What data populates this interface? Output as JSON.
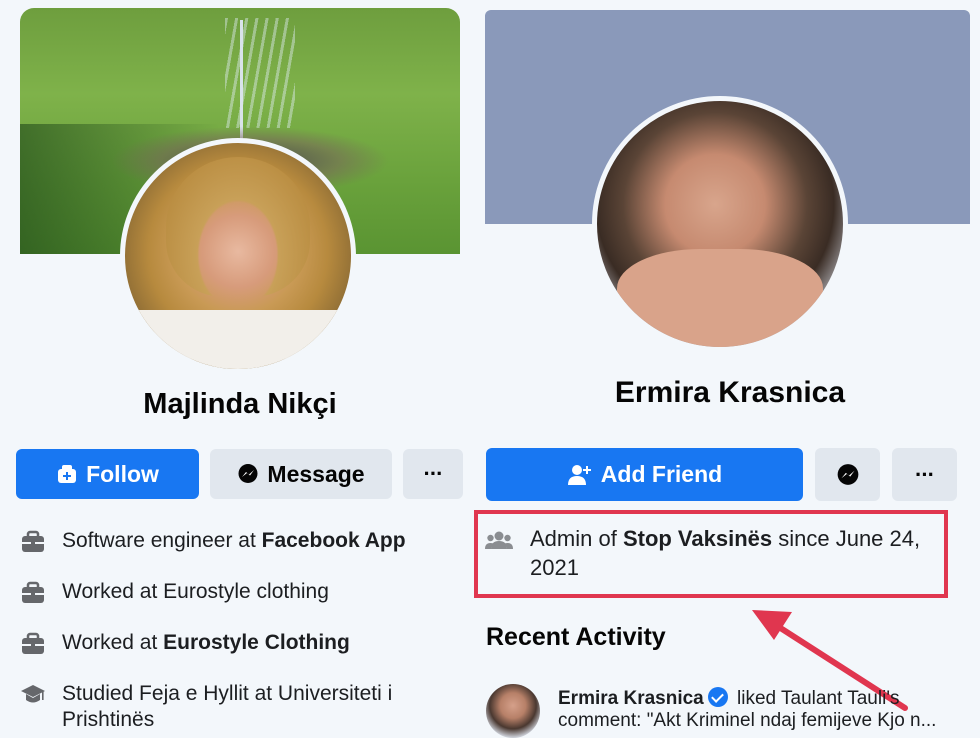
{
  "colors": {
    "primary": "#1877f2",
    "secondary_button": "#e1e7ee",
    "highlight_box": "#e0364f",
    "background": "#f3f7fb"
  },
  "left_profile": {
    "name": "Majlinda Nikçi",
    "follow_label": "Follow",
    "message_label": "Message",
    "more_label": "···",
    "info": [
      {
        "icon": "briefcase-icon",
        "prefix": "Software engineer at ",
        "bold": "Facebook App",
        "suffix": ""
      },
      {
        "icon": "briefcase-icon",
        "prefix": "Worked at Eurostyle clothing",
        "bold": "",
        "suffix": ""
      },
      {
        "icon": "briefcase-icon",
        "prefix": "Worked at ",
        "bold": "Eurostyle Clothing",
        "suffix": ""
      },
      {
        "icon": "graduation-cap-icon",
        "prefix": "Studied Feja e Hyllit at Universiteti i Prishtinës",
        "bold": "",
        "suffix": ""
      }
    ]
  },
  "right_profile": {
    "name": "Ermira Krasnica",
    "add_friend_label": "Add Friend",
    "more_label": "···",
    "admin": {
      "prefix": "Admin of ",
      "group": "Stop Vaksinës",
      "suffix": " since June 24, 2021"
    },
    "recent_activity_title": "Recent Activity",
    "activity": {
      "actor": "Ermira Krasnica",
      "text": " liked Taulant Tauli's comment: \"Akt Kriminel ndaj femijeve Kjo n..."
    }
  }
}
